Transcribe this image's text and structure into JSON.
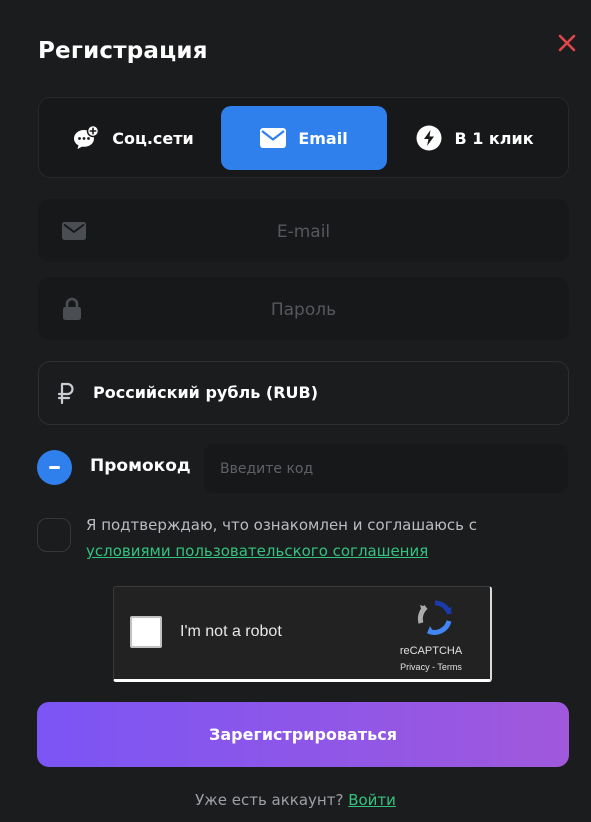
{
  "title": "Регистрация",
  "tabs": [
    {
      "label": "Соц.сети",
      "icon": "chat-plus-icon"
    },
    {
      "label": "Email",
      "icon": "mail-icon",
      "active": true
    },
    {
      "label": "В 1 клик",
      "icon": "lightning-icon"
    }
  ],
  "fields": {
    "email_placeholder": "E-mail",
    "password_placeholder": "Пароль"
  },
  "currency": {
    "value": "Российский рубль (RUB)",
    "icon": "ruble-icon"
  },
  "promo": {
    "label": "Промокод",
    "placeholder": "Введите код"
  },
  "agreement": {
    "text": "Я подтверждаю, что ознакомлен и соглашаюсь с",
    "link": "условиями пользовательского соглашения"
  },
  "recaptcha": {
    "label": "I'm not a robot",
    "brand": "reCAPTCHA",
    "privacy": "Privacy",
    "separator": " - ",
    "terms": "Terms"
  },
  "submit_label": "Зарегистрироваться",
  "footer": {
    "question": "Уже есть аккаунт?",
    "login_link": "Войти"
  },
  "colors": {
    "background": "#1b1c1e",
    "accent_blue": "#2f80ed",
    "link_green": "#35c27e",
    "close_red": "#e0464b",
    "button_gradient_start": "#7b55f5",
    "button_gradient_end": "#a058dc"
  }
}
